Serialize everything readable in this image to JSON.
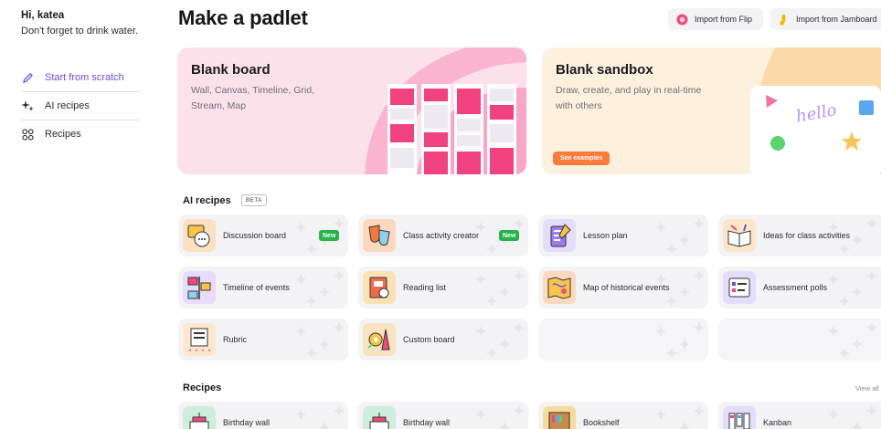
{
  "sidebar": {
    "greeting": "Hi, katea",
    "message": "Don't forget to drink water.",
    "items": [
      {
        "label": "Start from scratch",
        "icon": "pencil-icon",
        "active": true
      },
      {
        "label": "AI recipes",
        "icon": "sparkle-icon",
        "active": false
      },
      {
        "label": "Recipes",
        "icon": "grid-icon",
        "active": false
      }
    ]
  },
  "header": {
    "title": "Make a padlet",
    "import_flip": "Import from Flip",
    "import_jamboard": "Import from Jamboard"
  },
  "hero": {
    "board": {
      "title": "Blank board",
      "subtitle_line1": "Wall, Canvas, Timeline, Grid,",
      "subtitle_line2": "Stream, Map"
    },
    "sandbox": {
      "title": "Blank sandbox",
      "subtitle_line1": "Draw, create, and play in real-time",
      "subtitle_line2": "with others",
      "button": "See examples",
      "handwriting": "hello"
    }
  },
  "ai_recipes": {
    "title": "AI recipes",
    "badge": "BETA",
    "new_label": "New",
    "items": [
      {
        "label": "Discussion board",
        "icon": "chat-illustration-icon",
        "is_new": true
      },
      {
        "label": "Class activity creator",
        "icon": "masks-illustration-icon",
        "is_new": true
      },
      {
        "label": "Lesson plan",
        "icon": "clipboard-illustration-icon",
        "is_new": false
      },
      {
        "label": "Ideas for class activities",
        "icon": "book-illustration-icon",
        "is_new": false
      },
      {
        "label": "Timeline of events",
        "icon": "timeline-illustration-icon",
        "is_new": false
      },
      {
        "label": "Reading list",
        "icon": "reading-illustration-icon",
        "is_new": false
      },
      {
        "label": "Map of historical events",
        "icon": "map-illustration-icon",
        "is_new": false
      },
      {
        "label": "Assessment polls",
        "icon": "poll-illustration-icon",
        "is_new": false
      },
      {
        "label": "Rubric",
        "icon": "rubric-illustration-icon",
        "is_new": false
      },
      {
        "label": "Custom board",
        "icon": "custom-illustration-icon",
        "is_new": false
      }
    ]
  },
  "recipes": {
    "title": "Recipes",
    "view_all": "View all",
    "items": [
      {
        "label": "Birthday wall",
        "icon": "cake-illustration-icon"
      },
      {
        "label": "Birthday wall",
        "icon": "cake-illustration-icon"
      },
      {
        "label": "Bookshelf",
        "icon": "bookshelf-illustration-icon"
      },
      {
        "label": "Kanban",
        "icon": "kanban-illustration-icon"
      }
    ]
  },
  "colors": {
    "accent": "#6b4ddb",
    "new_badge": "#27b24a",
    "see_examples": "#ff7a3d",
    "board_bg": "#fde1ea",
    "sandbox_bg": "#fdf1de"
  }
}
